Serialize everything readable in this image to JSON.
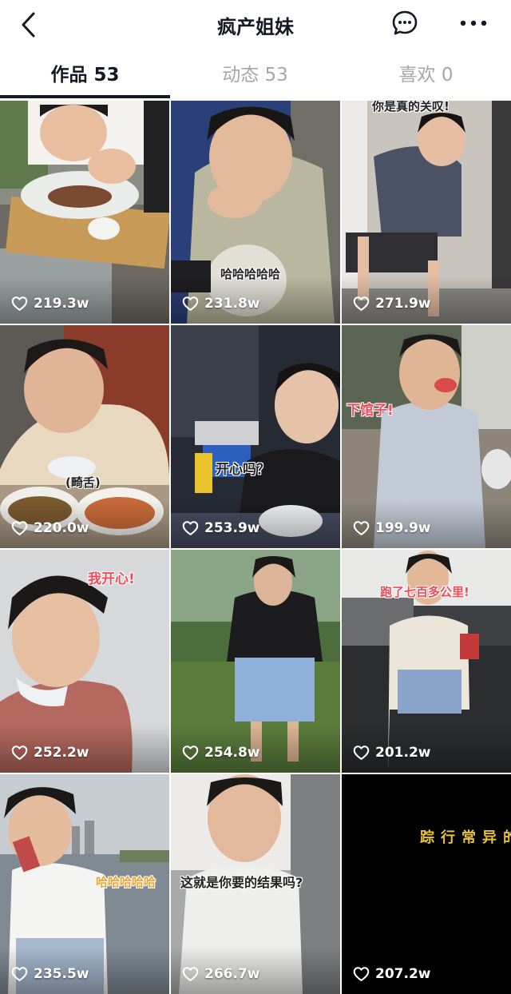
{
  "header": {
    "title": "疯产姐妹",
    "back_icon": "chevron-left-icon",
    "message_icon": "message-bubble-icon",
    "more_icon": "more-dots-icon"
  },
  "tabs": [
    {
      "label": "作品 53",
      "active": true
    },
    {
      "label": "动态 53",
      "active": false
    },
    {
      "label": "喜欢 0",
      "active": false
    }
  ],
  "videos": [
    {
      "likes": "219.3w",
      "caption": ""
    },
    {
      "likes": "231.8w",
      "caption": "哈哈哈哈哈"
    },
    {
      "likes": "271.9w",
      "caption": "你是真的关叹!"
    },
    {
      "likes": "220.0w",
      "caption": "(畸舌)"
    },
    {
      "likes": "253.9w",
      "caption": "开心吗？"
    },
    {
      "likes": "199.9w",
      "caption": "下馆子!"
    },
    {
      "likes": "252.2w",
      "caption": "我开心!"
    },
    {
      "likes": "254.8w",
      "caption": ""
    },
    {
      "likes": "201.2w",
      "caption": "跑了七百多公里!"
    },
    {
      "likes": "235.5w",
      "caption": "哈哈哈哈哈"
    },
    {
      "likes": "266.7w",
      "caption": "这就是你要的结果吗?"
    },
    {
      "likes": "207.2w",
      "caption": "闺蜜的异常行踪"
    }
  ],
  "colors": {
    "accent_text": "#161823",
    "inactive_tab": "#a6a7ab",
    "caption_red": "#f24a5a",
    "caption_yellow": "#e9c42c",
    "caption_dark": "#222222"
  }
}
